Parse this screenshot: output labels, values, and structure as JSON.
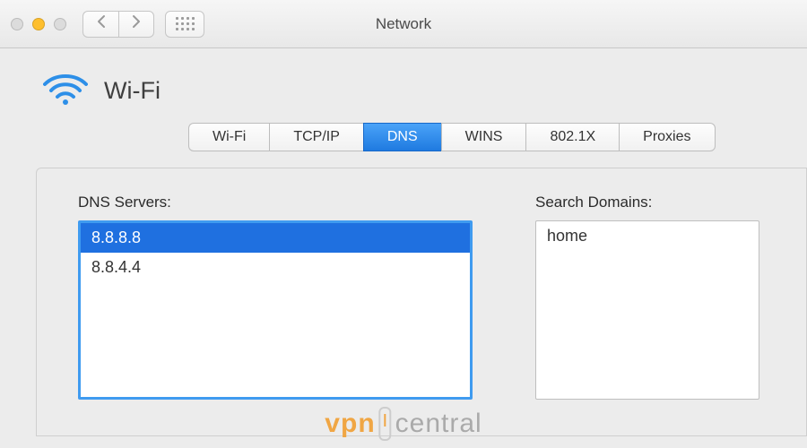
{
  "window": {
    "title": "Network"
  },
  "header": {
    "interface": "Wi-Fi"
  },
  "tabs": [
    {
      "label": "Wi-Fi",
      "active": false
    },
    {
      "label": "TCP/IP",
      "active": false
    },
    {
      "label": "DNS",
      "active": true
    },
    {
      "label": "WINS",
      "active": false
    },
    {
      "label": "802.1X",
      "active": false
    },
    {
      "label": "Proxies",
      "active": false
    }
  ],
  "dns": {
    "label": "DNS Servers:",
    "servers": [
      "8.8.8.8",
      "8.8.4.4"
    ],
    "selected_index": 0
  },
  "search_domains": {
    "label": "Search Domains:",
    "domains": [
      "home"
    ]
  },
  "watermark": {
    "part1": "vpn",
    "part2": "central"
  }
}
